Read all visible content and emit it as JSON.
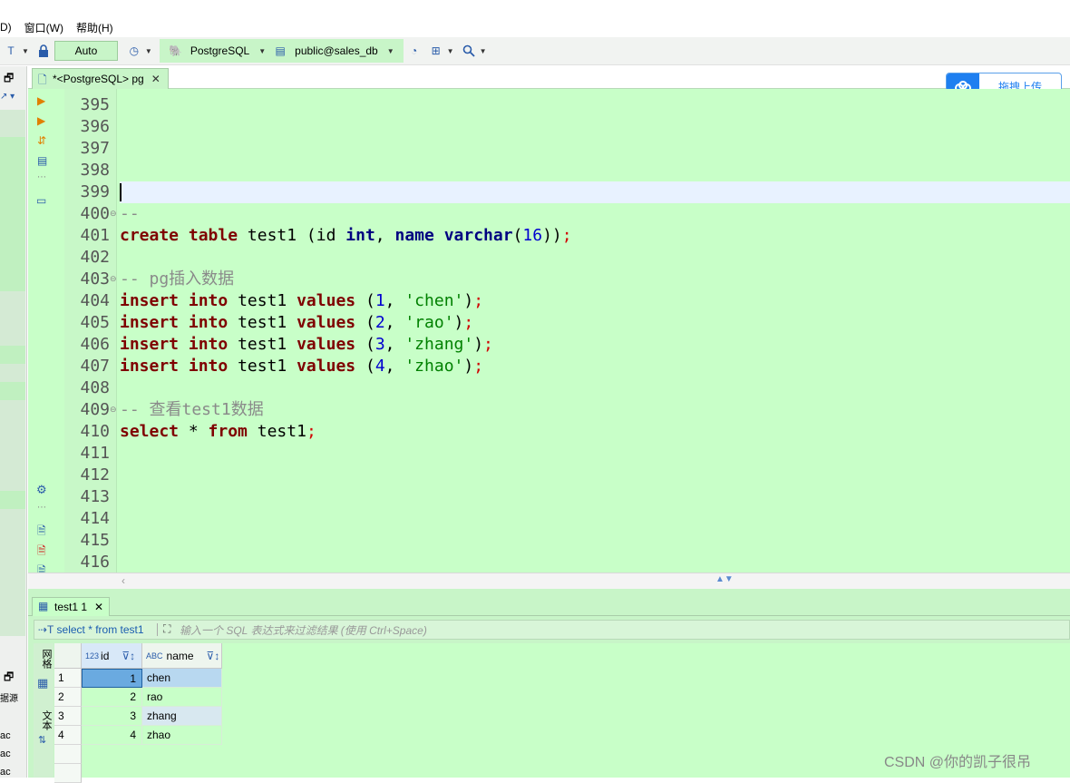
{
  "menu": {
    "items": [
      "D)",
      "窗口(W)",
      "帮助(H)"
    ]
  },
  "toolbar": {
    "commit_mode": "Auto",
    "datasource": "PostgreSQL",
    "schema": "public@sales_db"
  },
  "upload_button": {
    "label": "拖拽上传"
  },
  "editor_tab": {
    "title": "*<PostgreSQL> pg",
    "close": "✕"
  },
  "editor": {
    "lines": [
      {
        "n": "395",
        "fold": "",
        "code": []
      },
      {
        "n": "396",
        "fold": "",
        "code": []
      },
      {
        "n": "397",
        "fold": "",
        "code": []
      },
      {
        "n": "398",
        "fold": "",
        "code": []
      },
      {
        "n": "399",
        "fold": "",
        "code": []
      },
      {
        "n": "400",
        "fold": "⊖",
        "code": [
          [
            "cmt",
            "--"
          ]
        ]
      },
      {
        "n": "401",
        "fold": "",
        "code": [
          [
            "kw",
            "create"
          ],
          [
            "p",
            " "
          ],
          [
            "kw",
            "table"
          ],
          [
            "p",
            " test1 (id "
          ],
          [
            "tp",
            "int"
          ],
          [
            "p",
            ", "
          ],
          [
            "tp",
            "name"
          ],
          [
            "p",
            " "
          ],
          [
            "tp",
            "varchar"
          ],
          [
            "p",
            "("
          ],
          [
            "num",
            "16"
          ],
          [
            "p",
            "))"
          ],
          [
            "semi",
            ";"
          ]
        ]
      },
      {
        "n": "402",
        "fold": "",
        "code": []
      },
      {
        "n": "403",
        "fold": "⊖",
        "code": [
          [
            "cmt",
            "-- pg插入数据"
          ]
        ]
      },
      {
        "n": "404",
        "fold": "",
        "code": [
          [
            "kw",
            "insert"
          ],
          [
            "p",
            " "
          ],
          [
            "kw",
            "into"
          ],
          [
            "p",
            " test1 "
          ],
          [
            "kw",
            "values"
          ],
          [
            "p",
            " ("
          ],
          [
            "num",
            "1"
          ],
          [
            "p",
            ", "
          ],
          [
            "str",
            "'chen'"
          ],
          [
            "p",
            ")"
          ],
          [
            "semi",
            ";"
          ]
        ]
      },
      {
        "n": "405",
        "fold": "",
        "code": [
          [
            "kw",
            "insert"
          ],
          [
            "p",
            " "
          ],
          [
            "kw",
            "into"
          ],
          [
            "p",
            " test1 "
          ],
          [
            "kw",
            "values"
          ],
          [
            "p",
            " ("
          ],
          [
            "num",
            "2"
          ],
          [
            "p",
            ", "
          ],
          [
            "str",
            "'rao'"
          ],
          [
            "p",
            ")"
          ],
          [
            "semi",
            ";"
          ]
        ]
      },
      {
        "n": "406",
        "fold": "",
        "code": [
          [
            "kw",
            "insert"
          ],
          [
            "p",
            " "
          ],
          [
            "kw",
            "into"
          ],
          [
            "p",
            " test1 "
          ],
          [
            "kw",
            "values"
          ],
          [
            "p",
            " ("
          ],
          [
            "num",
            "3"
          ],
          [
            "p",
            ", "
          ],
          [
            "str",
            "'zhang'"
          ],
          [
            "p",
            ")"
          ],
          [
            "semi",
            ";"
          ]
        ]
      },
      {
        "n": "407",
        "fold": "",
        "code": [
          [
            "kw",
            "insert"
          ],
          [
            "p",
            " "
          ],
          [
            "kw",
            "into"
          ],
          [
            "p",
            " test1 "
          ],
          [
            "kw",
            "values"
          ],
          [
            "p",
            " ("
          ],
          [
            "num",
            "4"
          ],
          [
            "p",
            ", "
          ],
          [
            "str",
            "'zhao'"
          ],
          [
            "p",
            ")"
          ],
          [
            "semi",
            ";"
          ]
        ]
      },
      {
        "n": "408",
        "fold": "",
        "code": []
      },
      {
        "n": "409",
        "fold": "⊖",
        "code": [
          [
            "cmt",
            "-- 查看test1数据"
          ]
        ]
      },
      {
        "n": "410",
        "fold": "",
        "code": [
          [
            "kw",
            "select"
          ],
          [
            "p",
            " * "
          ],
          [
            "kw",
            "from"
          ],
          [
            "p",
            " test1"
          ],
          [
            "semi",
            ";"
          ]
        ]
      },
      {
        "n": "411",
        "fold": "",
        "code": []
      },
      {
        "n": "412",
        "fold": "",
        "code": []
      },
      {
        "n": "413",
        "fold": "",
        "code": []
      },
      {
        "n": "414",
        "fold": "",
        "code": []
      },
      {
        "n": "415",
        "fold": "",
        "code": []
      },
      {
        "n": "416",
        "fold": "",
        "code": []
      }
    ]
  },
  "results": {
    "tab_title": "test1 1",
    "tab_close": "✕",
    "query": "select * from test1",
    "filter_placeholder": "输入一个 SQL 表达式来过滤结果 (使用 Ctrl+Space)",
    "vtab_grid": "网格",
    "vtab_text": "文本",
    "columns": [
      {
        "type": "123",
        "name": "id"
      },
      {
        "type": "ABC",
        "name": "name"
      }
    ],
    "rows": [
      {
        "num": "1",
        "id": "1",
        "name": "chen"
      },
      {
        "num": "2",
        "id": "2",
        "name": "rao"
      },
      {
        "num": "3",
        "id": "3",
        "name": "zhang"
      },
      {
        "num": "4",
        "id": "4",
        "name": "zhao"
      }
    ]
  },
  "left_panel": {
    "labels": [
      "据源",
      "ac",
      "ac",
      "ac"
    ]
  },
  "watermark": "CSDN @你的凯子很吊"
}
